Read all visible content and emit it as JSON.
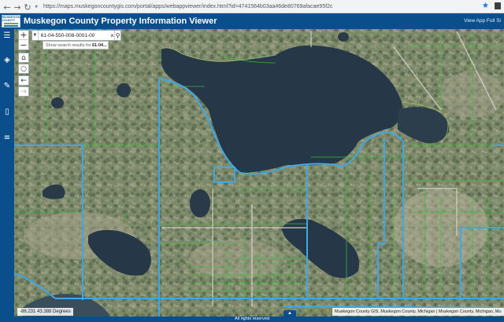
{
  "browser": {
    "url": "https://maps.muskegoncountygis.com/portal/apps/webappviewer/index.html?id=4741564b03aa46de80769afacae95f2c",
    "back_icon": "arrow-left-icon",
    "forward_icon": "arrow-right-icon",
    "reload_icon": "reload-icon"
  },
  "app": {
    "title": "Muskegon County Property Information Viewer",
    "logo_text": "MUSKEGON COUNTY",
    "header_link": "View App Full Si"
  },
  "left_toolbar": [
    {
      "name": "menu-icon"
    },
    {
      "name": "layers-icon"
    },
    {
      "name": "draw-icon"
    },
    {
      "name": "comment-icon"
    },
    {
      "name": "list-icon"
    }
  ],
  "search": {
    "value": "61-04-550-008-0001-00",
    "suggestion_prefix": "Show search results for ",
    "suggestion_term": "61-04..."
  },
  "map": {
    "coordinates": "-86.231 43.388 Degrees",
    "attribution": "Muskegon County GIS, Muskegon County, Michigan | Muskegon County, Michigan, Mu",
    "footer": "All rights reserved",
    "accent_color": "#0a4e8c",
    "parcel_boundary_color": "#3fa7e6"
  }
}
